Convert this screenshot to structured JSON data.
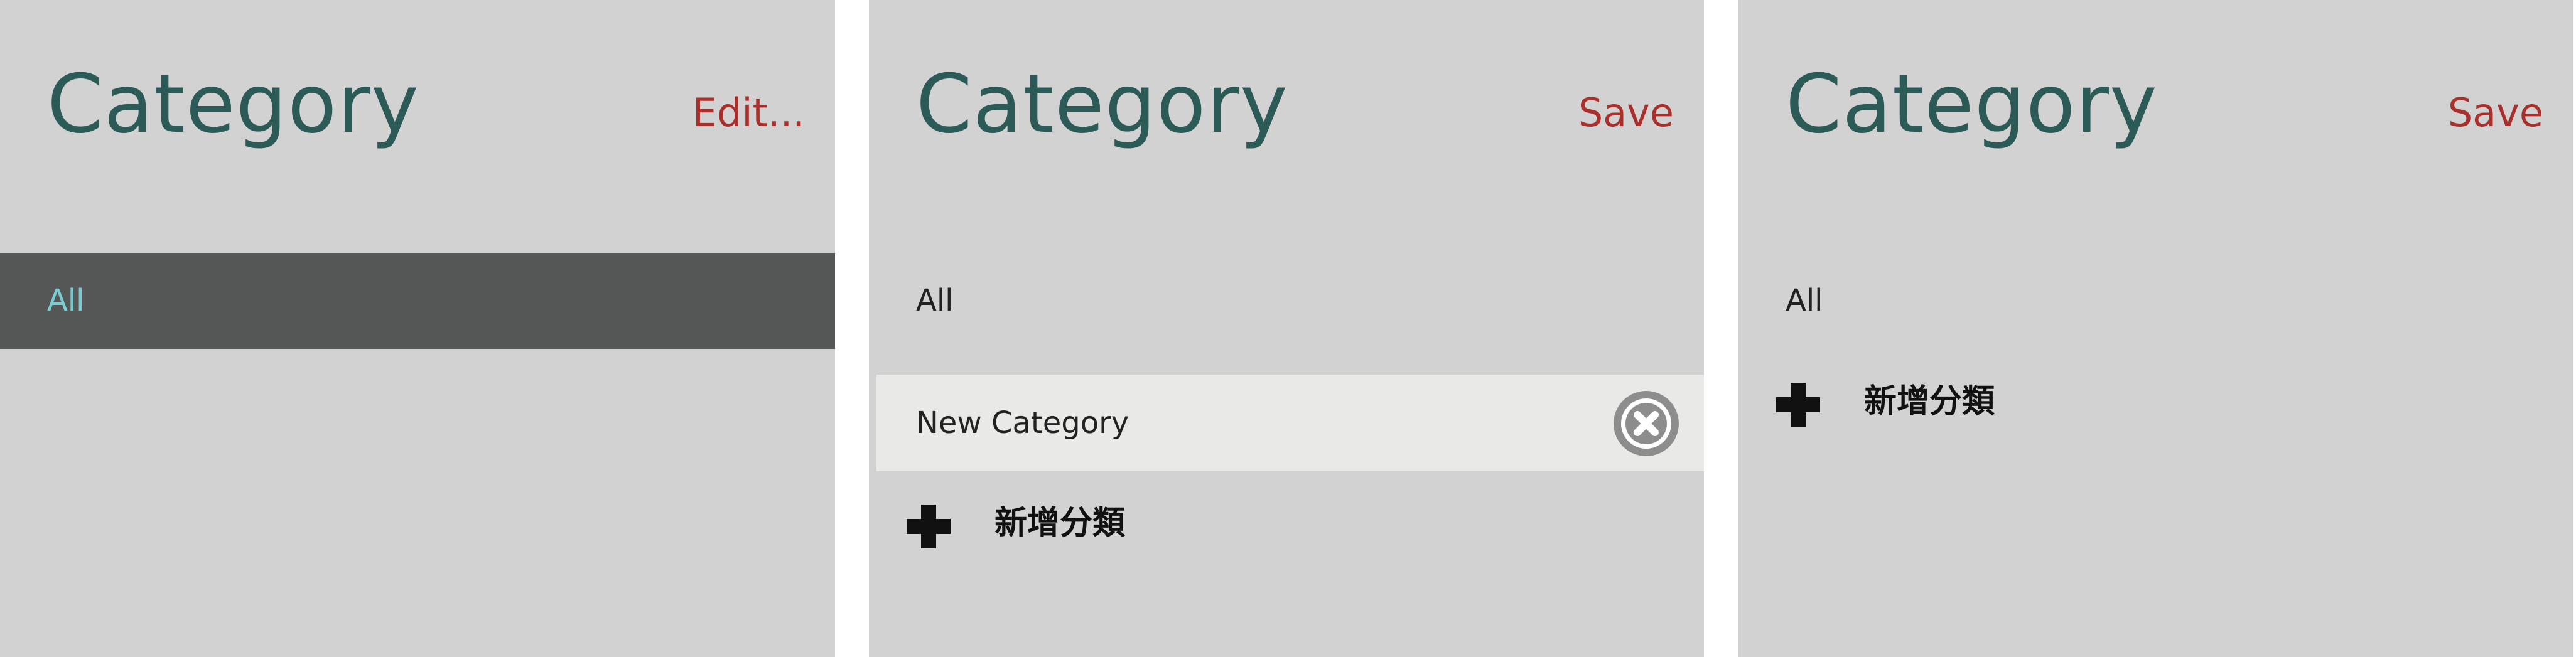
{
  "panels": [
    {
      "title": "Category",
      "action_label": "Edit...",
      "items": [
        {
          "label": "All",
          "selected": true
        }
      ]
    },
    {
      "title": "Category",
      "action_label": "Save",
      "items": [
        {
          "label": "All",
          "selected": false
        },
        {
          "label": "New Category",
          "editing": true,
          "delete_icon": "close-circle-icon"
        }
      ],
      "add_label": "新增分類",
      "add_icon": "plus-icon"
    },
    {
      "title": "Category",
      "action_label": "Save",
      "items": [
        {
          "label": "All",
          "selected": false
        }
      ],
      "add_label": "新增分類",
      "add_icon": "plus-icon"
    }
  ],
  "colors": {
    "panel_background": "#d2d2d2",
    "title": "#2b5a57",
    "action": "#a8302c",
    "selected_row_background": "#555656",
    "selected_row_text": "#79cdd2",
    "editing_row_background": "#e9e9e7"
  }
}
